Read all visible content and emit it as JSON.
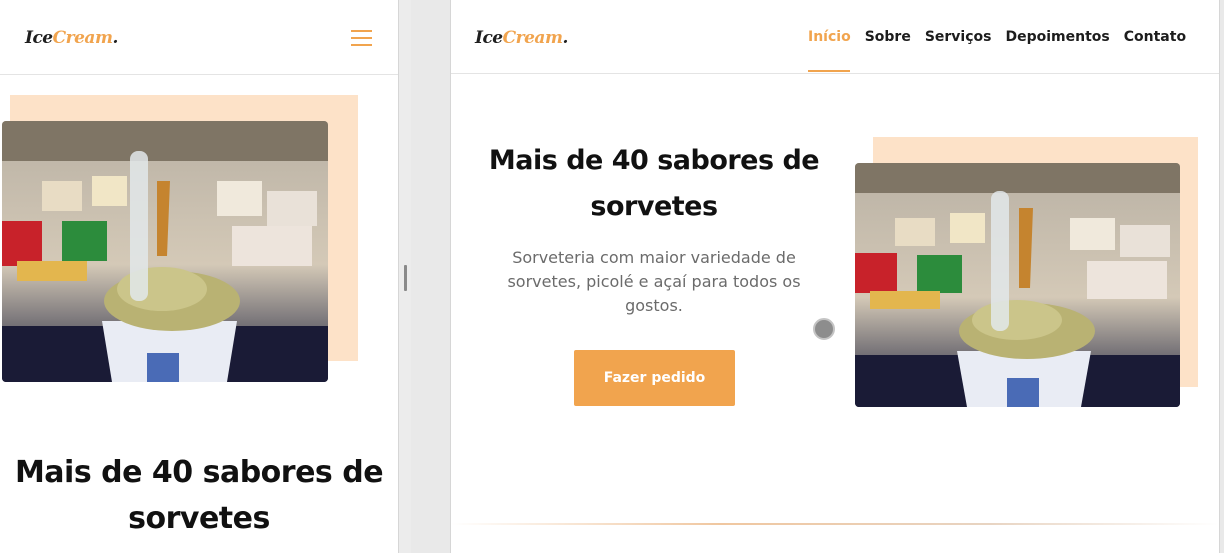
{
  "brand": {
    "logo_ice": "Ice",
    "logo_cream": "Cream",
    "logo_dot": "."
  },
  "nav": {
    "items": [
      "Início",
      "Sobre",
      "Serviços",
      "Depoimentos",
      "Contato"
    ],
    "active_index": 0
  },
  "hero": {
    "title_line1": "Mais de 40 sabores de",
    "title_line2": "sorvetes",
    "subtitle": "Sorveteria com maior variedade de sorvetes, picolé e açaí para todos os gostos.",
    "cta_label": "Fazer pedido"
  },
  "colors": {
    "accent": "#f1a44e",
    "peach_block": "#fde2c8",
    "text_dark": "#111111",
    "text_muted": "#6b6b6b"
  },
  "icons": {
    "menu": "hamburger-menu-icon",
    "photo": "ice-cream-cup-photo"
  }
}
